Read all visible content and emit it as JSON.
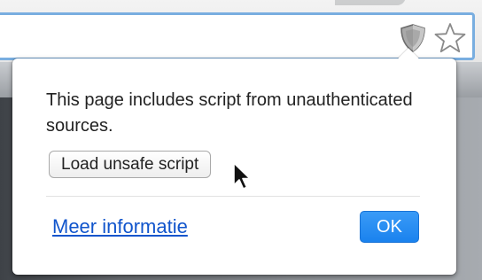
{
  "toolbar": {
    "shield_icon": "shield-icon",
    "star_icon": "star-icon",
    "focus_color": "#79aee0"
  },
  "popup": {
    "message": "This page includes script from unauthenticated sources.",
    "load_button_label": "Load unsafe script",
    "more_info_link": "Meer informatie",
    "ok_button_label": "OK",
    "accent_color": "#1a82ee",
    "link_color": "#1155cc"
  },
  "cursor": "arrow-cursor-icon"
}
